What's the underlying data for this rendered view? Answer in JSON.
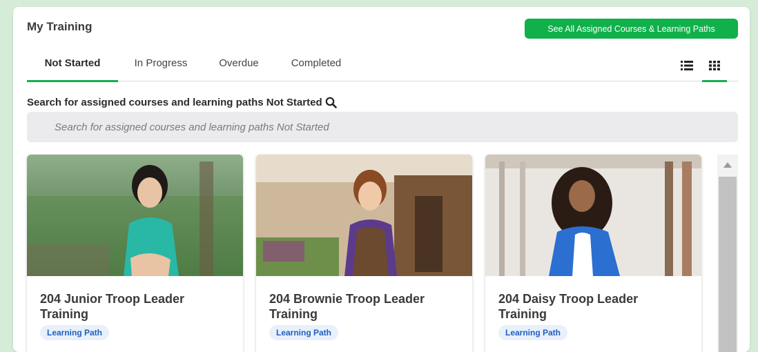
{
  "header": {
    "title": "My Training",
    "see_all_label": "See All Assigned Courses & Learning Paths"
  },
  "tabs": [
    {
      "label": "Not Started",
      "active": true
    },
    {
      "label": "In Progress",
      "active": false
    },
    {
      "label": "Overdue",
      "active": false
    },
    {
      "label": "Completed",
      "active": false
    }
  ],
  "view_toggle": {
    "list_icon": "list-icon",
    "grid_icon": "grid-icon",
    "active": "grid"
  },
  "search": {
    "label": "Search for assigned courses and learning paths Not Started",
    "placeholder": "Search for assigned courses and learning paths Not Started",
    "value": ""
  },
  "cards": [
    {
      "title": "204 Junior Troop Leader Training",
      "badge": "Learning Path"
    },
    {
      "title": "204 Brownie Troop Leader Training",
      "badge": "Learning Path"
    },
    {
      "title": "204 Daisy Troop Leader Training",
      "badge": "Learning Path"
    }
  ],
  "colors": {
    "accent": "#10b04a",
    "page_bg": "#d5ecd8",
    "badge_bg": "#e8f0fb",
    "badge_text": "#1f5fbf"
  }
}
